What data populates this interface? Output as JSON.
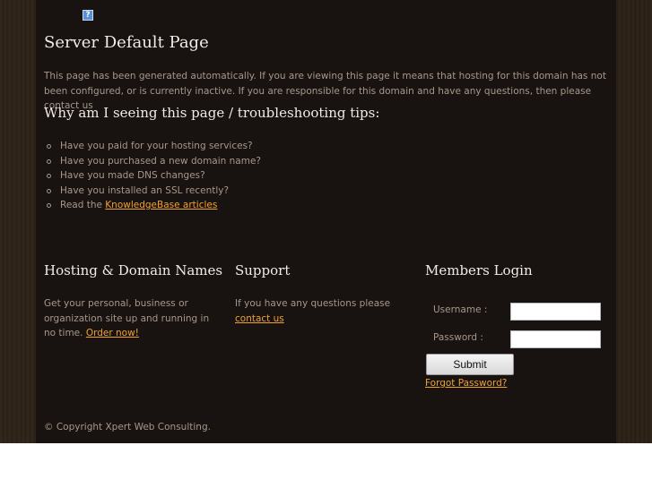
{
  "header": {
    "logo_icon": "question-mark-icon",
    "logo_glyph": "?",
    "title": "Server Default Page"
  },
  "intro": {
    "text": "This page has been generated automatically. If you are viewing this page it means that hosting for this domain has not been configured, or is currently inactive. If you are responsible for this domain and have any questions, then please contact us"
  },
  "tips": {
    "heading": "Why am I seeing this page / troubleshooting tips:",
    "items": [
      "Have you paid for your hosting services?",
      "Have you purchased a new domain name?",
      "Have you made DNS changes?",
      "Have you installed an SSL recently?"
    ],
    "last_item_prefix": "Read the ",
    "last_item_link": "KnowledgeBase articles"
  },
  "hosting": {
    "title": "Hosting & Domain Names",
    "text": "Get your personal, business or organization site up and running in no time. ",
    "link": "Order now!"
  },
  "support": {
    "title": "Support",
    "text": "If you have any questions please ",
    "link": "contact us"
  },
  "login": {
    "title": "Members Login",
    "username_label": "Username :",
    "username_value": "",
    "password_label": "Password :",
    "password_value": "",
    "submit_label": "Submit",
    "forgot_link": "Forgot Password?"
  },
  "footer": {
    "copyright": "© Copyright Xpert Web Consulting."
  },
  "colors": {
    "panel_background": "#181210",
    "body_text": "#a8988a",
    "heading_text": "#f1ece4",
    "link": "#f0a22e"
  }
}
